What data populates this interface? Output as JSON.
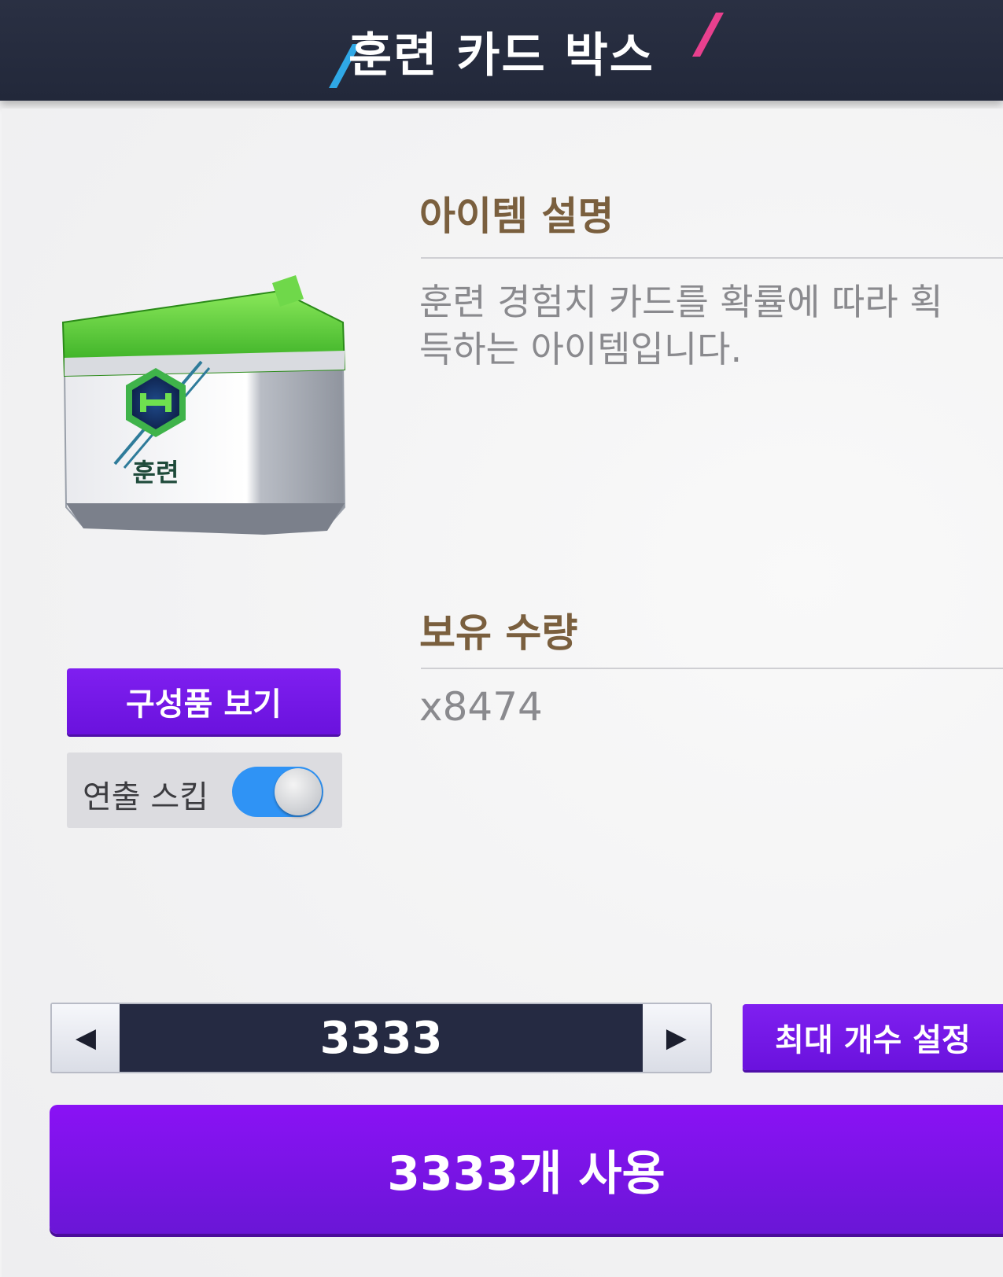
{
  "header": {
    "title": "훈련 카드 박스"
  },
  "item": {
    "image_label": "훈련",
    "description_title": "아이템 설명",
    "description": "훈련 경험치 카드를 확률에 따라 획득하는 아이템입니다.",
    "quantity_title": "보유 수량",
    "quantity": "x8474"
  },
  "controls": {
    "components_button": "구성품 보기",
    "skip_label": "연출 스킵",
    "skip_enabled": true,
    "stepper_value": "3333",
    "decrement_icon": "triangle-left-icon",
    "increment_icon": "triangle-right-icon",
    "max_button": "최대 개수 설정",
    "use_button": "3333개 사용"
  },
  "colors": {
    "header_bg": "#252a3c",
    "accent_purple": "#7a18ea",
    "toggle_on": "#2f93f5",
    "title_brown": "#7a5f3e",
    "slash_blue": "#2fa8e6",
    "slash_pink": "#e8408e"
  }
}
